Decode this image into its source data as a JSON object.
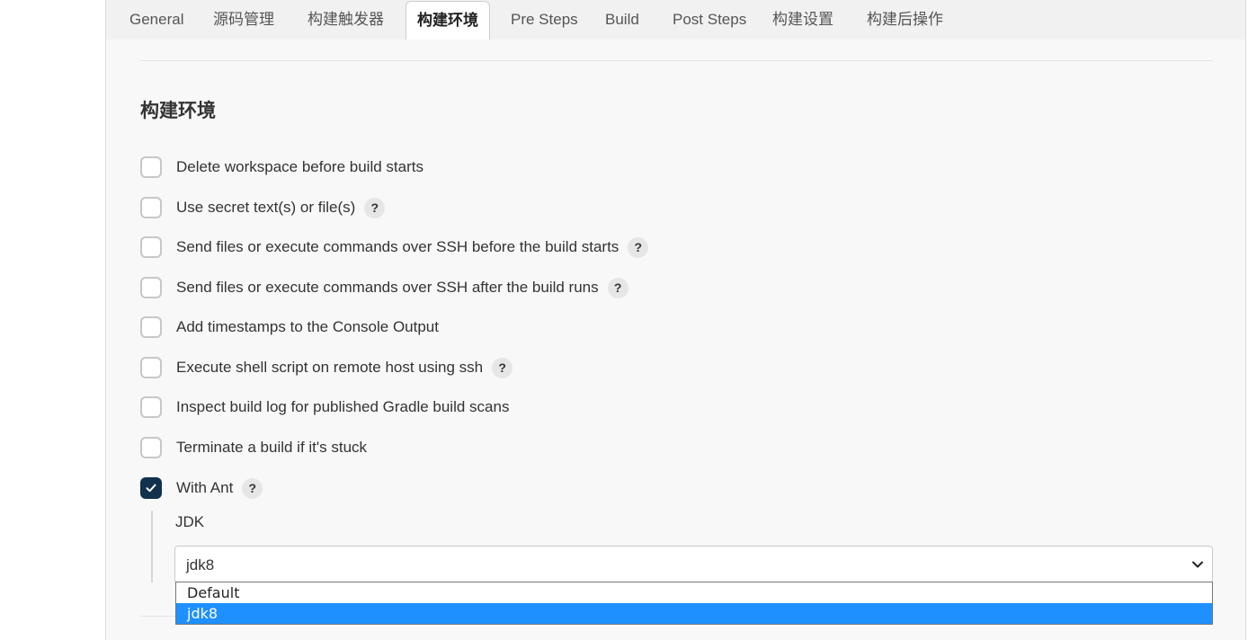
{
  "tabs": [
    {
      "label": "General"
    },
    {
      "label": "源码管理"
    },
    {
      "label": "构建触发器"
    },
    {
      "label": "构建环境",
      "active": true
    },
    {
      "label": "Pre Steps"
    },
    {
      "label": "Build"
    },
    {
      "label": "Post Steps"
    },
    {
      "label": "构建设置"
    },
    {
      "label": "构建后操作"
    }
  ],
  "section": {
    "title": "构建环境"
  },
  "options": [
    {
      "label": "Delete workspace before build starts",
      "checked": false,
      "help": false
    },
    {
      "label": "Use secret text(s) or file(s)",
      "checked": false,
      "help": true
    },
    {
      "label": "Send files or execute commands over SSH before the build starts",
      "checked": false,
      "help": true
    },
    {
      "label": "Send files or execute commands over SSH after the build runs",
      "checked": false,
      "help": true
    },
    {
      "label": "Add timestamps to the Console Output",
      "checked": false,
      "help": false
    },
    {
      "label": "Execute shell script on remote host using ssh",
      "checked": false,
      "help": true
    },
    {
      "label": "Inspect build log for published Gradle build scans",
      "checked": false,
      "help": false
    },
    {
      "label": "Terminate a build if it's stuck",
      "checked": false,
      "help": false
    },
    {
      "label": "With Ant",
      "checked": true,
      "help": true
    }
  ],
  "help_glyph": "?",
  "ant": {
    "jdk_label": "JDK",
    "jdk_value": "jdk8",
    "jdk_options": [
      {
        "label": "Default",
        "selected": false
      },
      {
        "label": "jdk8",
        "selected": true
      }
    ]
  },
  "colors": {
    "checked_fill": "#12314d",
    "dropdown_highlight": "#1e90ff"
  }
}
